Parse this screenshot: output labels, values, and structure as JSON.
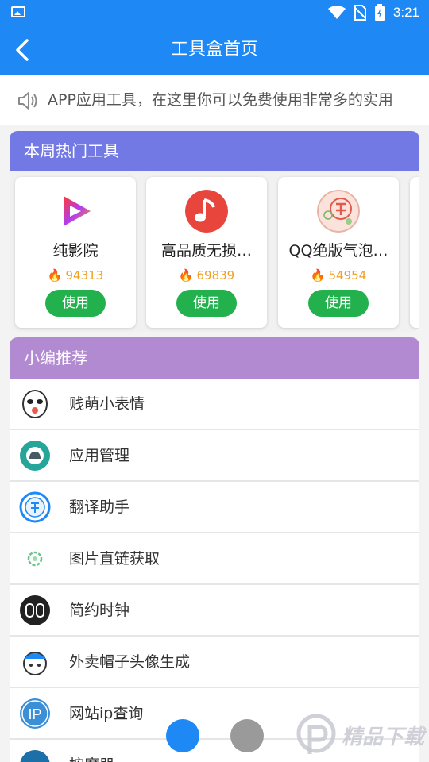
{
  "status_bar": {
    "time": "3:21"
  },
  "header": {
    "title": "工具盒首页"
  },
  "notice": {
    "text": "APP应用工具，在这里你可以免费使用非常多的实用"
  },
  "hot_tools": {
    "title": "本周热门工具",
    "items": [
      {
        "name": "纯影院",
        "heat": "94313",
        "button": "使用"
      },
      {
        "name": "高品质无损…",
        "heat": "69839",
        "button": "使用"
      },
      {
        "name": "QQ绝版气泡…",
        "heat": "54954",
        "button": "使用"
      }
    ]
  },
  "recommend": {
    "title": "小编推荐",
    "items": [
      {
        "name": "贱萌小表情"
      },
      {
        "name": "应用管理"
      },
      {
        "name": "翻译助手"
      },
      {
        "name": "图片直链获取"
      },
      {
        "name": "简约时钟"
      },
      {
        "name": "外卖帽子头像生成"
      },
      {
        "name": "网站ip查询"
      },
      {
        "name": "按摩器"
      }
    ]
  },
  "watermark": {
    "text": "精品下载"
  },
  "colors": {
    "primary": "#1e88f5",
    "hot_header": "#7279e4",
    "recommend_header": "#b28ad1",
    "use_button": "#22b14c",
    "heat": "#f0a020"
  }
}
